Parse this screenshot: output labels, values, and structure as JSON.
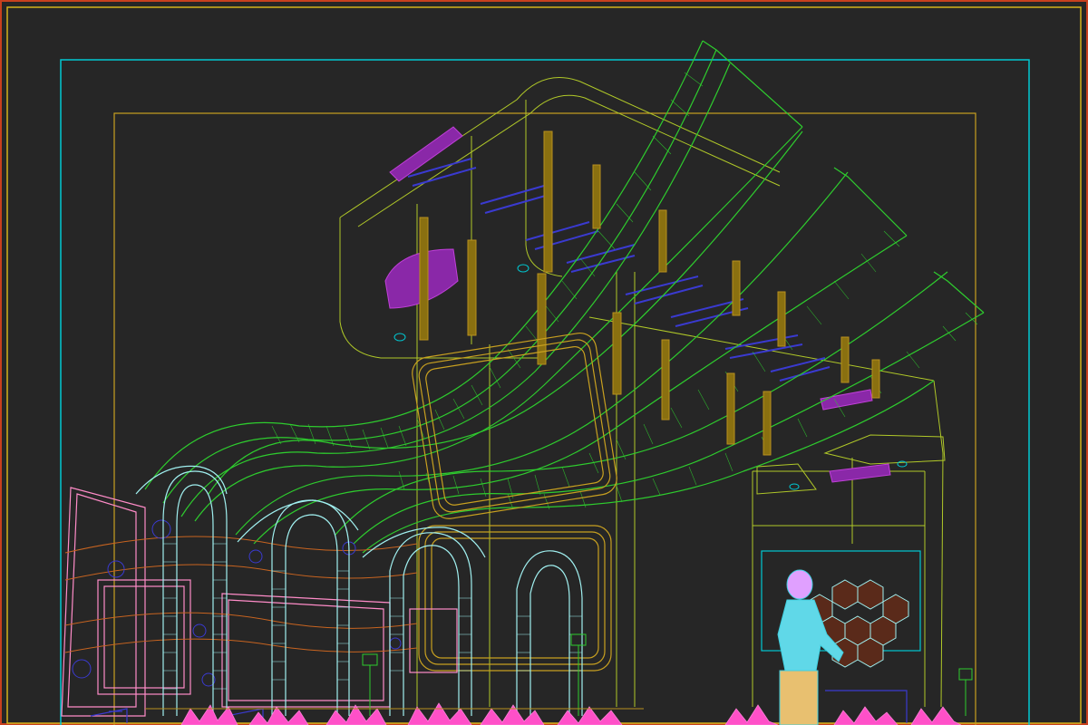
{
  "viewport": {
    "background": "#262626",
    "layer_colors": {
      "outer_frame": "#d4b21c",
      "safe_frame": "#00c8d2",
      "inner_frame": "#c8a020",
      "canopy": "#2ecc2e",
      "canopy_edge": "#8ed41c",
      "beams": "#b8901e",
      "spotlights": "#c040d8",
      "ribs": "#a0f0f0",
      "blue_details": "#3a3ad0",
      "booth": "#b0c828",
      "planters": "#ff50c8",
      "figure": "#40d0e0",
      "figure_head": "#e0a0ff",
      "panels": "#ff8cc8",
      "orange_lines": "#c86420"
    }
  }
}
